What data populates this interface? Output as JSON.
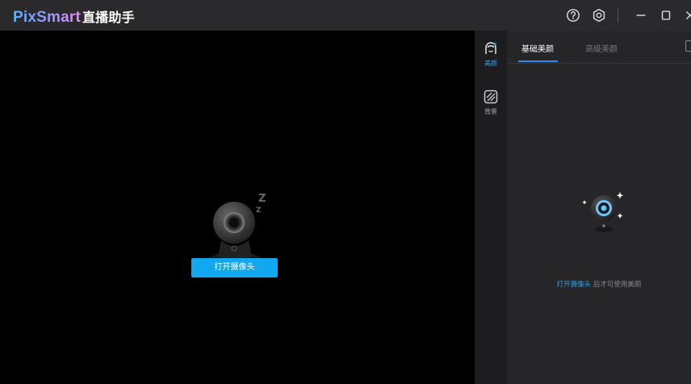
{
  "app": {
    "brand": "PixSmart",
    "subtitle": "直播助手"
  },
  "titlebar": {
    "icons": [
      "help-icon",
      "settings-icon",
      "minimize-icon",
      "maximize-icon",
      "close-icon"
    ]
  },
  "stage": {
    "open_camera_label": "打开摄像头",
    "sleep_glyph": "Z"
  },
  "sidebar": {
    "items": [
      {
        "label": "美颜",
        "icon": "beauty-face-icon",
        "active": true
      },
      {
        "label": "背景",
        "icon": "background-icon",
        "active": false
      }
    ]
  },
  "panel": {
    "tabs": [
      {
        "label": "基础美颜",
        "active": true
      },
      {
        "label": "高级美颜",
        "active": false
      }
    ],
    "hint_link": "打开摄像头",
    "hint_rest": " 后才可使用美颜"
  },
  "colors": {
    "accent": "#11a8ef",
    "link": "#2aa5f4",
    "tab_active_underline": "#2d8cf0",
    "titlebar_bg": "#2a2a2c",
    "sidebar_bg": "#1d1d1f",
    "panel_bg": "#262628"
  }
}
